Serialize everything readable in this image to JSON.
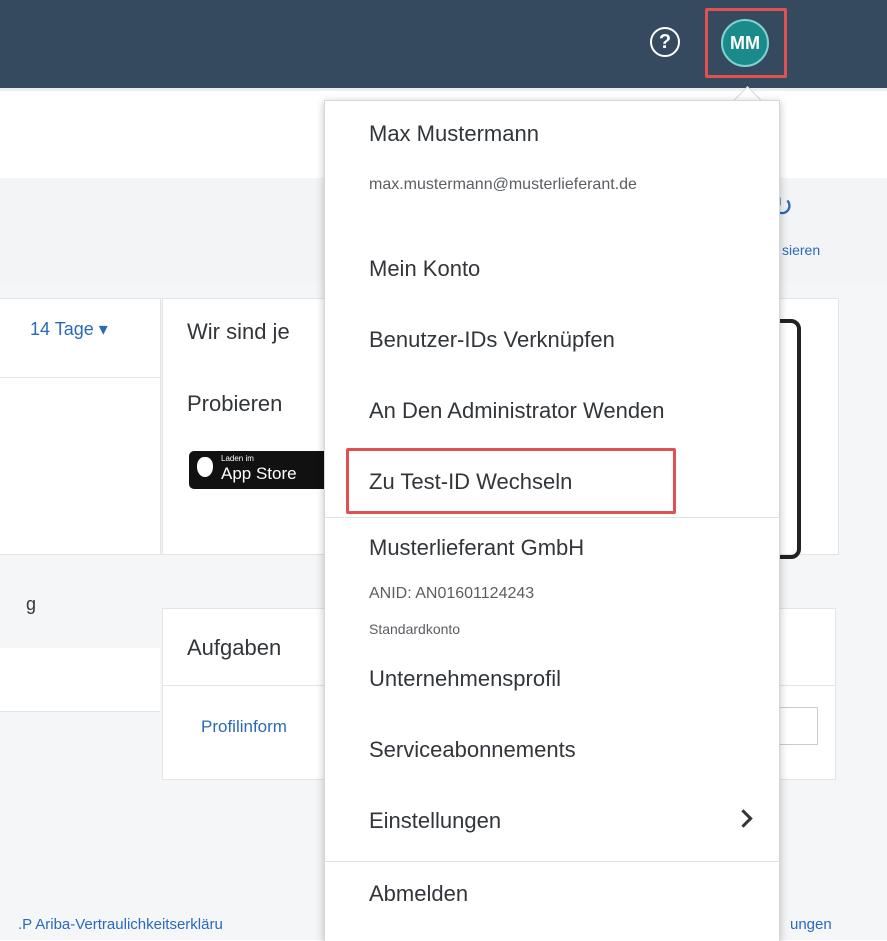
{
  "header": {
    "help_icon": "help-circle-icon",
    "help_glyph": "?",
    "avatar_initials": "MM",
    "avatar_color": "#1b8a8a",
    "highlight_color": "#e05252",
    "bar_color": "#354a5f"
  },
  "background": {
    "refresh_label": "sieren",
    "tage_label": "14 Tage ▾",
    "wir_sind": "Wir sind je",
    "probieren": "Probieren",
    "appstore_small": "Laden im",
    "appstore_label": "App Store",
    "left_g": "g",
    "aufgaben": "Aufgaben",
    "profil_link": "Profilinform",
    "footer_left": ".P Ariba-Vertraulichkeitserkläru",
    "footer_right": "ungen"
  },
  "menu": {
    "user_name": "Max Mustermann",
    "user_email": "max.mustermann@musterlieferant.de",
    "mein_konto": "Mein Konto",
    "benutzer_ids": "Benutzer-IDs Verknüpfen",
    "admin": "An Den Administrator Wenden",
    "test_id": "Zu Test-ID Wechseln",
    "company": "Musterlieferant GmbH",
    "anid": "ANID: AN01601124243",
    "standardkonto": "Standardkonto",
    "unternehmensprofil": "Unternehmensprofil",
    "serviceabonnements": "Serviceabonnements",
    "einstellungen": "Einstellungen",
    "abmelden": "Abmelden"
  }
}
